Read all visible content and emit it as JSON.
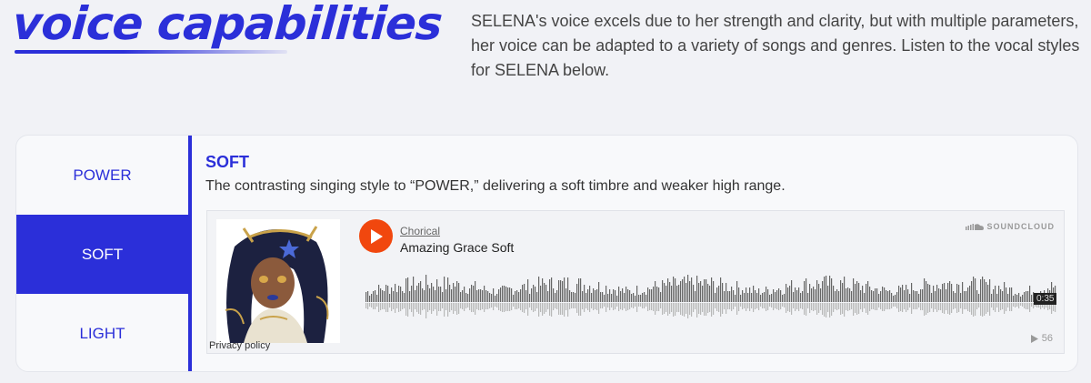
{
  "header": {
    "title": "voice capabilities",
    "intro": "SELENA's voice excels due to her strength and clarity, but with multiple parameters, her voice can be adapted to a variety of songs and genres. Listen to the vocal styles for SELENA below."
  },
  "tabs": [
    {
      "label": "POWER",
      "active": false
    },
    {
      "label": "SOFT",
      "active": true
    },
    {
      "label": "LIGHT",
      "active": false
    }
  ],
  "panel": {
    "title": "SOFT",
    "description": "The contrasting singing style to “POWER,” delivering a soft timbre and weaker high range."
  },
  "player": {
    "artist": "Chorical",
    "track": "Amazing Grace Soft",
    "brand": "SOUNDCLOUD",
    "duration": "0:35",
    "plays": "56",
    "privacy_label": "Privacy policy",
    "play_icon": "play-icon",
    "accent": "#f1470e"
  },
  "colors": {
    "brand_blue": "#2b2fd9",
    "background": "#f1f2f6"
  }
}
